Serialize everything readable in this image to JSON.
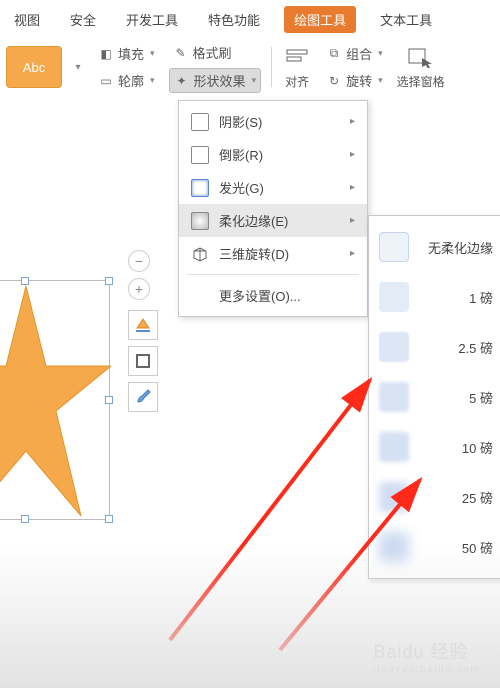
{
  "tabs": {
    "t0": "视图",
    "t1": "安全",
    "t2": "开发工具",
    "t3": "特色功能",
    "t4": "绘图工具",
    "t5": "文本工具"
  },
  "ribbon": {
    "abc": "Abc",
    "fill": "填充",
    "outline": "轮廓",
    "format_painter": "格式刷",
    "shape_effect": "形状效果",
    "align": "对齐",
    "group": "组合",
    "rotate": "旋转",
    "select_pane": "选择窗格"
  },
  "menu": {
    "shadow": "阴影(S)",
    "reflection": "倒影(R)",
    "glow": "发光(G)",
    "soft_edge": "柔化边缘(E)",
    "rotation_3d": "三维旋转(D)",
    "more": "更多设置(O)..."
  },
  "submenu": {
    "none": "无柔化边缘",
    "p1": "1 磅",
    "p2": "2.5 磅",
    "p3": "5 磅",
    "p4": "10 磅",
    "p5": "25 磅",
    "p6": "50 磅"
  },
  "watermark": {
    "main": "Baidu 经验",
    "sub": "jingyan.baidu.com"
  }
}
